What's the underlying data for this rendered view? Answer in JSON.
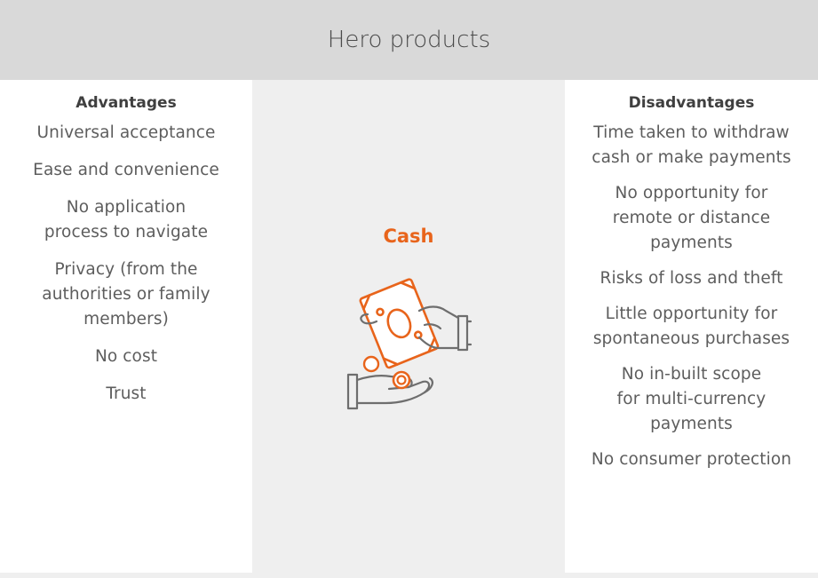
{
  "header": {
    "title": "Hero products"
  },
  "advantages": {
    "heading": "Advantages",
    "items": [
      "Universal acceptance",
      "Ease and convenience",
      "No application\nprocess to navigate",
      "Privacy (from the\nauthorities or family\nmembers)",
      "No cost",
      "Trust"
    ]
  },
  "center": {
    "title": "Cash",
    "accent_color": "#e8641b",
    "icon": "hands-exchanging-cash-icon"
  },
  "disadvantages": {
    "heading": "Disadvantages",
    "items": [
      "Time taken to withdraw\ncash or make payments",
      "No opportunity for\nremote or distance\npayments",
      "Risks of loss and theft",
      "Little opportunity for\nspontaneous purchases",
      "No in-built scope\nfor multi-currency\npayments",
      "No consumer protection"
    ]
  }
}
